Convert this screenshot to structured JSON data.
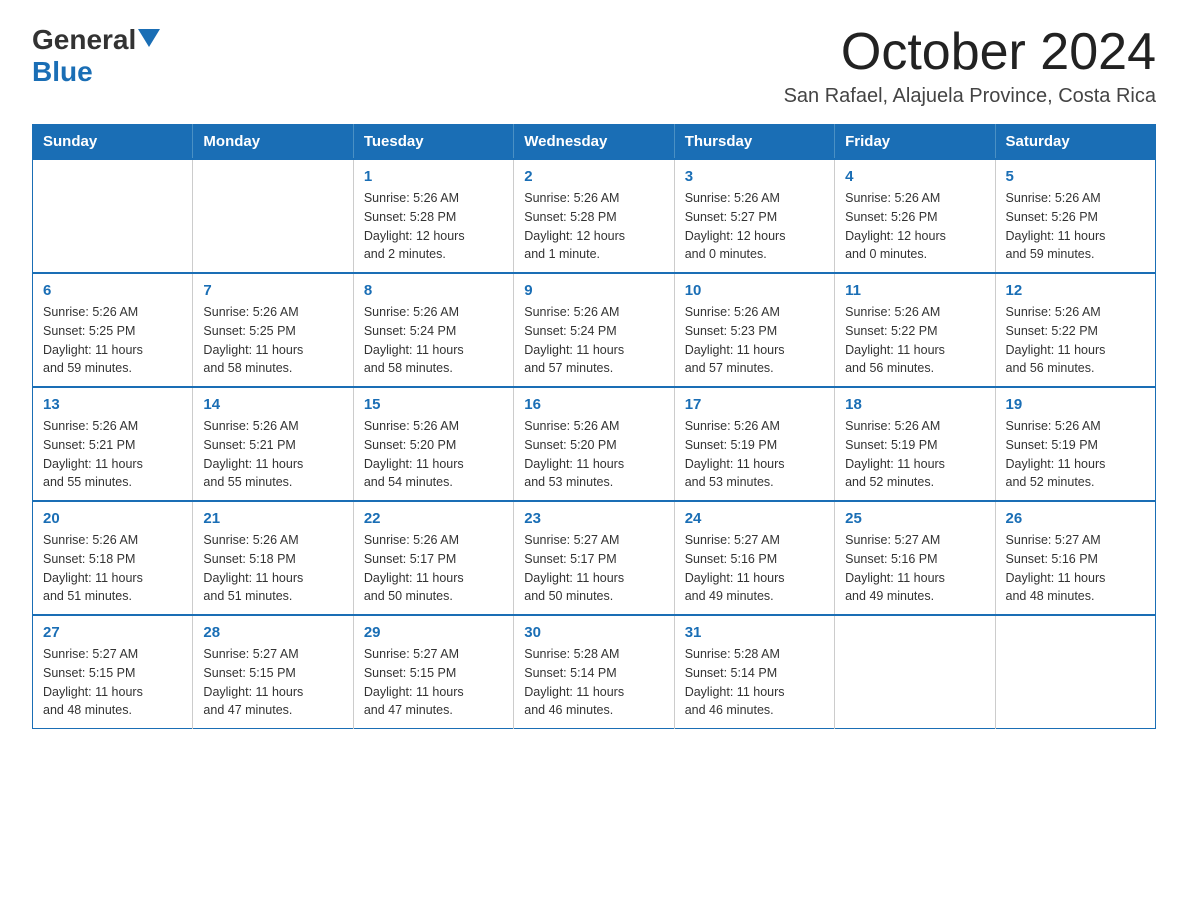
{
  "header": {
    "logo_general": "General",
    "logo_blue": "Blue",
    "month_title": "October 2024",
    "location": "San Rafael, Alajuela Province, Costa Rica"
  },
  "calendar": {
    "days_of_week": [
      "Sunday",
      "Monday",
      "Tuesday",
      "Wednesday",
      "Thursday",
      "Friday",
      "Saturday"
    ],
    "weeks": [
      [
        {
          "day": "",
          "info": ""
        },
        {
          "day": "",
          "info": ""
        },
        {
          "day": "1",
          "info": "Sunrise: 5:26 AM\nSunset: 5:28 PM\nDaylight: 12 hours\nand 2 minutes."
        },
        {
          "day": "2",
          "info": "Sunrise: 5:26 AM\nSunset: 5:28 PM\nDaylight: 12 hours\nand 1 minute."
        },
        {
          "day": "3",
          "info": "Sunrise: 5:26 AM\nSunset: 5:27 PM\nDaylight: 12 hours\nand 0 minutes."
        },
        {
          "day": "4",
          "info": "Sunrise: 5:26 AM\nSunset: 5:26 PM\nDaylight: 12 hours\nand 0 minutes."
        },
        {
          "day": "5",
          "info": "Sunrise: 5:26 AM\nSunset: 5:26 PM\nDaylight: 11 hours\nand 59 minutes."
        }
      ],
      [
        {
          "day": "6",
          "info": "Sunrise: 5:26 AM\nSunset: 5:25 PM\nDaylight: 11 hours\nand 59 minutes."
        },
        {
          "day": "7",
          "info": "Sunrise: 5:26 AM\nSunset: 5:25 PM\nDaylight: 11 hours\nand 58 minutes."
        },
        {
          "day": "8",
          "info": "Sunrise: 5:26 AM\nSunset: 5:24 PM\nDaylight: 11 hours\nand 58 minutes."
        },
        {
          "day": "9",
          "info": "Sunrise: 5:26 AM\nSunset: 5:24 PM\nDaylight: 11 hours\nand 57 minutes."
        },
        {
          "day": "10",
          "info": "Sunrise: 5:26 AM\nSunset: 5:23 PM\nDaylight: 11 hours\nand 57 minutes."
        },
        {
          "day": "11",
          "info": "Sunrise: 5:26 AM\nSunset: 5:22 PM\nDaylight: 11 hours\nand 56 minutes."
        },
        {
          "day": "12",
          "info": "Sunrise: 5:26 AM\nSunset: 5:22 PM\nDaylight: 11 hours\nand 56 minutes."
        }
      ],
      [
        {
          "day": "13",
          "info": "Sunrise: 5:26 AM\nSunset: 5:21 PM\nDaylight: 11 hours\nand 55 minutes."
        },
        {
          "day": "14",
          "info": "Sunrise: 5:26 AM\nSunset: 5:21 PM\nDaylight: 11 hours\nand 55 minutes."
        },
        {
          "day": "15",
          "info": "Sunrise: 5:26 AM\nSunset: 5:20 PM\nDaylight: 11 hours\nand 54 minutes."
        },
        {
          "day": "16",
          "info": "Sunrise: 5:26 AM\nSunset: 5:20 PM\nDaylight: 11 hours\nand 53 minutes."
        },
        {
          "day": "17",
          "info": "Sunrise: 5:26 AM\nSunset: 5:19 PM\nDaylight: 11 hours\nand 53 minutes."
        },
        {
          "day": "18",
          "info": "Sunrise: 5:26 AM\nSunset: 5:19 PM\nDaylight: 11 hours\nand 52 minutes."
        },
        {
          "day": "19",
          "info": "Sunrise: 5:26 AM\nSunset: 5:19 PM\nDaylight: 11 hours\nand 52 minutes."
        }
      ],
      [
        {
          "day": "20",
          "info": "Sunrise: 5:26 AM\nSunset: 5:18 PM\nDaylight: 11 hours\nand 51 minutes."
        },
        {
          "day": "21",
          "info": "Sunrise: 5:26 AM\nSunset: 5:18 PM\nDaylight: 11 hours\nand 51 minutes."
        },
        {
          "day": "22",
          "info": "Sunrise: 5:26 AM\nSunset: 5:17 PM\nDaylight: 11 hours\nand 50 minutes."
        },
        {
          "day": "23",
          "info": "Sunrise: 5:27 AM\nSunset: 5:17 PM\nDaylight: 11 hours\nand 50 minutes."
        },
        {
          "day": "24",
          "info": "Sunrise: 5:27 AM\nSunset: 5:16 PM\nDaylight: 11 hours\nand 49 minutes."
        },
        {
          "day": "25",
          "info": "Sunrise: 5:27 AM\nSunset: 5:16 PM\nDaylight: 11 hours\nand 49 minutes."
        },
        {
          "day": "26",
          "info": "Sunrise: 5:27 AM\nSunset: 5:16 PM\nDaylight: 11 hours\nand 48 minutes."
        }
      ],
      [
        {
          "day": "27",
          "info": "Sunrise: 5:27 AM\nSunset: 5:15 PM\nDaylight: 11 hours\nand 48 minutes."
        },
        {
          "day": "28",
          "info": "Sunrise: 5:27 AM\nSunset: 5:15 PM\nDaylight: 11 hours\nand 47 minutes."
        },
        {
          "day": "29",
          "info": "Sunrise: 5:27 AM\nSunset: 5:15 PM\nDaylight: 11 hours\nand 47 minutes."
        },
        {
          "day": "30",
          "info": "Sunrise: 5:28 AM\nSunset: 5:14 PM\nDaylight: 11 hours\nand 46 minutes."
        },
        {
          "day": "31",
          "info": "Sunrise: 5:28 AM\nSunset: 5:14 PM\nDaylight: 11 hours\nand 46 minutes."
        },
        {
          "day": "",
          "info": ""
        },
        {
          "day": "",
          "info": ""
        }
      ]
    ]
  }
}
